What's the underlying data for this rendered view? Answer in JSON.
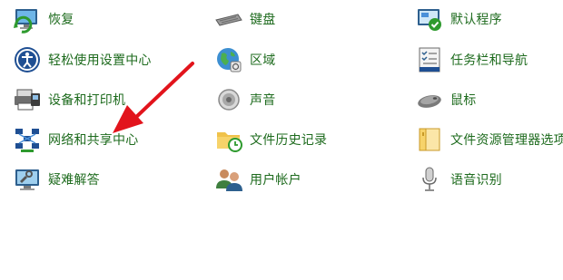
{
  "items": [
    {
      "label": "恢复",
      "icon": "recovery-icon"
    },
    {
      "label": "键盘",
      "icon": "keyboard-icon"
    },
    {
      "label": "默认程序",
      "icon": "default-programs-icon"
    },
    {
      "label": "轻松使用设置中心",
      "icon": "ease-of-access-icon"
    },
    {
      "label": "区域",
      "icon": "region-globe-icon"
    },
    {
      "label": "任务栏和导航",
      "icon": "taskbar-navigation-icon"
    },
    {
      "label": "设备和打印机",
      "icon": "devices-printers-icon"
    },
    {
      "label": "声音",
      "icon": "speaker-icon"
    },
    {
      "label": "鼠标",
      "icon": "mouse-icon"
    },
    {
      "label": "网络和共享中心",
      "icon": "network-sharing-icon"
    },
    {
      "label": "文件历史记录",
      "icon": "file-history-icon"
    },
    {
      "label": "文件资源管理器选项",
      "icon": "folder-options-icon"
    },
    {
      "label": "疑难解答",
      "icon": "troubleshooting-icon"
    },
    {
      "label": "用户帐户",
      "icon": "user-accounts-icon"
    },
    {
      "label": "语音识别",
      "icon": "microphone-icon"
    }
  ],
  "colors": {
    "link": "#1e6b1e",
    "arrow": "#e2141c"
  }
}
